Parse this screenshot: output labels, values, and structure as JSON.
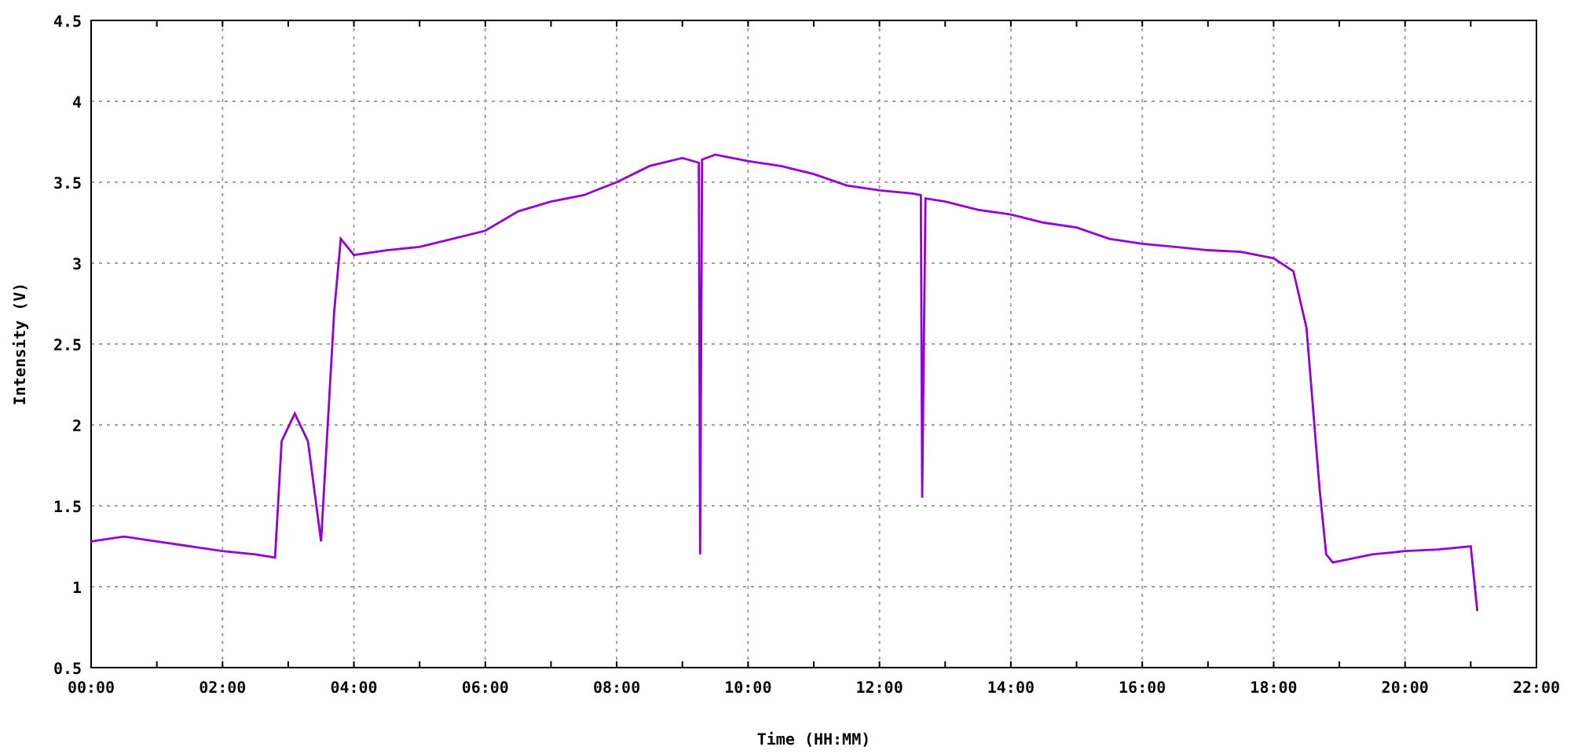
{
  "chart_data": {
    "type": "line",
    "xlabel": "Time (HH:MM)",
    "ylabel": "Intensity (V)",
    "x": [
      0,
      0.5,
      1,
      1.5,
      2,
      2.5,
      2.8,
      2.9,
      3.1,
      3.3,
      3.5,
      3.7,
      3.8,
      4,
      4.5,
      5,
      5.5,
      6,
      6.5,
      7,
      7.5,
      8,
      8.5,
      9,
      9.25,
      9.27,
      9.3,
      9.5,
      10,
      10.5,
      11,
      11.5,
      12,
      12.5,
      12.63,
      12.65,
      12.7,
      13,
      13.5,
      14,
      14.5,
      15,
      15.5,
      16,
      16.5,
      17,
      17.5,
      18,
      18.3,
      18.5,
      18.7,
      18.8,
      18.9,
      19.5,
      20,
      20.5,
      21,
      21.1
    ],
    "grid": true,
    "series": [
      {
        "color": "#9400d3",
        "values": [
          1.28,
          1.31,
          1.28,
          1.25,
          1.22,
          1.2,
          1.18,
          1.9,
          2.07,
          1.9,
          1.28,
          2.7,
          3.15,
          3.05,
          3.08,
          3.1,
          3.15,
          3.2,
          3.32,
          3.38,
          3.42,
          3.5,
          3.6,
          3.65,
          3.62,
          1.2,
          3.64,
          3.67,
          3.63,
          3.6,
          3.55,
          3.48,
          3.45,
          3.43,
          3.42,
          1.55,
          3.4,
          3.38,
          3.33,
          3.3,
          3.25,
          3.22,
          3.15,
          3.12,
          3.1,
          3.08,
          3.07,
          3.03,
          2.95,
          2.6,
          1.6,
          1.2,
          1.15,
          1.2,
          1.22,
          1.23,
          1.25,
          0.85
        ]
      }
    ],
    "xlim": [
      0,
      22
    ],
    "ylim": [
      0.5,
      4.5
    ],
    "xticks": [
      {
        "value": 0,
        "label": "00:00"
      },
      {
        "value": 2,
        "label": "02:00"
      },
      {
        "value": 4,
        "label": "04:00"
      },
      {
        "value": 6,
        "label": "06:00"
      },
      {
        "value": 8,
        "label": "08:00"
      },
      {
        "value": 10,
        "label": "10:00"
      },
      {
        "value": 12,
        "label": "12:00"
      },
      {
        "value": 14,
        "label": "14:00"
      },
      {
        "value": 16,
        "label": "16:00"
      },
      {
        "value": 18,
        "label": "18:00"
      },
      {
        "value": 20,
        "label": "20:00"
      },
      {
        "value": 22,
        "label": "22:00"
      }
    ],
    "yticks": [
      {
        "value": 0.5,
        "label": "0.5"
      },
      {
        "value": 1,
        "label": "1"
      },
      {
        "value": 1.5,
        "label": "1.5"
      },
      {
        "value": 2,
        "label": "2"
      },
      {
        "value": 2.5,
        "label": "2.5"
      },
      {
        "value": 3,
        "label": "3"
      },
      {
        "value": 3.5,
        "label": "3.5"
      },
      {
        "value": 4,
        "label": "4"
      },
      {
        "value": 4.5,
        "label": "4.5"
      }
    ]
  }
}
